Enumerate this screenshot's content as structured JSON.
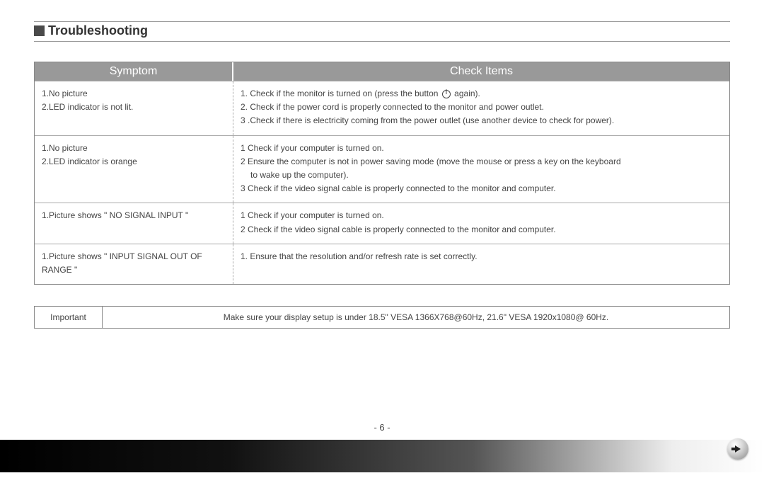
{
  "title": "Troubleshooting",
  "headers": {
    "symptom": "Symptom",
    "check": "Check Items"
  },
  "rows": [
    {
      "symptom": [
        "1.No picture",
        "2.LED indicator is not lit."
      ],
      "check_pre_icon": "1. Check if the monitor is turned on (press the button ",
      "check_post_icon": " again).",
      "check_rest": [
        "2. Check if the power cord is properly connected to the monitor and power outlet.",
        "3 .Check if there is electricity coming from the power outlet (use another device to check for power)."
      ]
    },
    {
      "symptom": [
        "1.No picture",
        "2.LED indicator is orange"
      ],
      "check": [
        "1 Check if your computer is turned on.",
        "2 Ensure the computer is not in power saving mode (move the mouse or press a key on the keyboard",
        "   to wake up the computer).",
        "3 Check if the video signal cable is properly connected to the monitor and computer."
      ]
    },
    {
      "symptom": [
        "1.Picture shows \" NO SIGNAL INPUT \""
      ],
      "check": [
        "1 Check if your computer is turned on.",
        "2 Check if the video signal cable is properly connected to the monitor and computer."
      ]
    },
    {
      "symptom": [
        "1.Picture shows \" INPUT SIGNAL OUT OF RANGE \""
      ],
      "check": [
        "1. Ensure that the resolution and/or refresh rate is set correctly."
      ]
    }
  ],
  "important": {
    "label": "Important",
    "text": "Make sure your display setup is under 18.5\" VESA 1366X768@60Hz, 21.6\" VESA 1920x1080@ 60Hz."
  },
  "page_number": "- 6 -"
}
